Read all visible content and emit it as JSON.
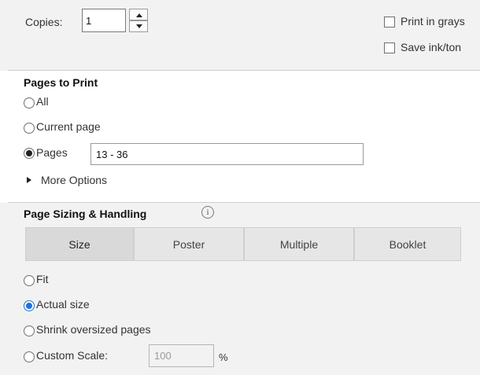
{
  "copies": {
    "label": "Copies:",
    "value": "1"
  },
  "options": {
    "grayscale_label": "Print in grays",
    "grayscale_checked": false,
    "save_ink_label": "Save ink/ton",
    "save_ink_checked": false
  },
  "pages_to_print": {
    "heading": "Pages to Print",
    "all_label": "All",
    "current_page_label": "Current page",
    "pages_label": "Pages",
    "pages_value": "13 - 36",
    "selected": "Pages",
    "more_options_label": "More Options"
  },
  "page_sizing": {
    "heading": "Page Sizing & Handling",
    "info_glyph": "i",
    "tabs": [
      "Size",
      "Poster",
      "Multiple",
      "Booklet"
    ],
    "active_tab": "Size",
    "fit_label": "Fit",
    "actual_size_label": "Actual size",
    "shrink_label": "Shrink oversized pages",
    "custom_scale_label": "Custom Scale:",
    "custom_scale_value": "100",
    "percent_label": "%",
    "selected": "Actual size"
  },
  "colors": {
    "accent": "#1f72d8",
    "panel_bg": "#f2f2f2"
  }
}
